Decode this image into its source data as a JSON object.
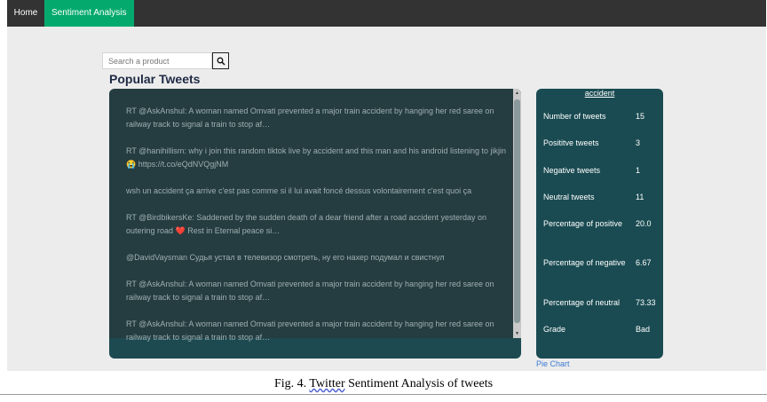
{
  "nav": {
    "items": [
      {
        "label": "Home"
      },
      {
        "label": "Sentiment Analysis"
      }
    ]
  },
  "search": {
    "placeholder": "Search a product",
    "button_icon": "search-icon"
  },
  "popular": {
    "title": "Popular Tweets"
  },
  "tweets": [
    {
      "text": "RT @AskAnshul: A woman named Omvati prevented a major train accident by hanging her red saree on railway track to signal a train to stop af…"
    },
    {
      "text": "RT @hanihillism: why i join this random tiktok live by accident and this man and his android listening to jikjin 😭  https://t.co/eQdNVQgjNM"
    },
    {
      "text": "wsh un accident ça arrive c'est pas comme si il lui avait foncé dessus volontairement c'est quoi ça"
    },
    {
      "text": "RT @BirdbikersKe: Saddened by the sudden death of a dear friend after a road accident yesterday on outering road ❤️  Rest in Eternal peace si…"
    },
    {
      "text": "@DavidVaysman Судья устал в телевизор смотреть, ну его нахер подумал и свистнул"
    },
    {
      "text": "RT @AskAnshul: A woman named Omvati prevented a major train accident by hanging her red saree on railway track to signal a train to stop af…"
    },
    {
      "text": "RT @AskAnshul: A woman named Omvati prevented a major train accident by hanging her red saree on railway track to signal a train to stop af…"
    }
  ],
  "stats": {
    "keyword": "accident",
    "rows": [
      {
        "label": "Number of tweets",
        "value": "15"
      },
      {
        "label": "Posititve tweets",
        "value": "3"
      },
      {
        "label": "Negative tweets",
        "value": "1"
      },
      {
        "label": "Neutral tweets",
        "value": "11"
      },
      {
        "label": "Percentage of positive",
        "value": "20.0"
      },
      {
        "label": "Percentage of negative",
        "value": "6.67"
      },
      {
        "label": "Percentage of neutral",
        "value": "73.33"
      },
      {
        "label": "Grade",
        "value": "Bad"
      }
    ]
  },
  "pie_link": "Pie Chart",
  "caption": {
    "prefix": "Fig. 4. ",
    "underlined": "Twitter",
    "suffix": " Sentiment Analysis of tweets"
  },
  "colors": {
    "nav_bg": "#333333",
    "nav_active": "#04aa6d",
    "panel_bg": "#1a4b52",
    "tweet_bg": "#253c40",
    "link": "#3a7bd5"
  }
}
